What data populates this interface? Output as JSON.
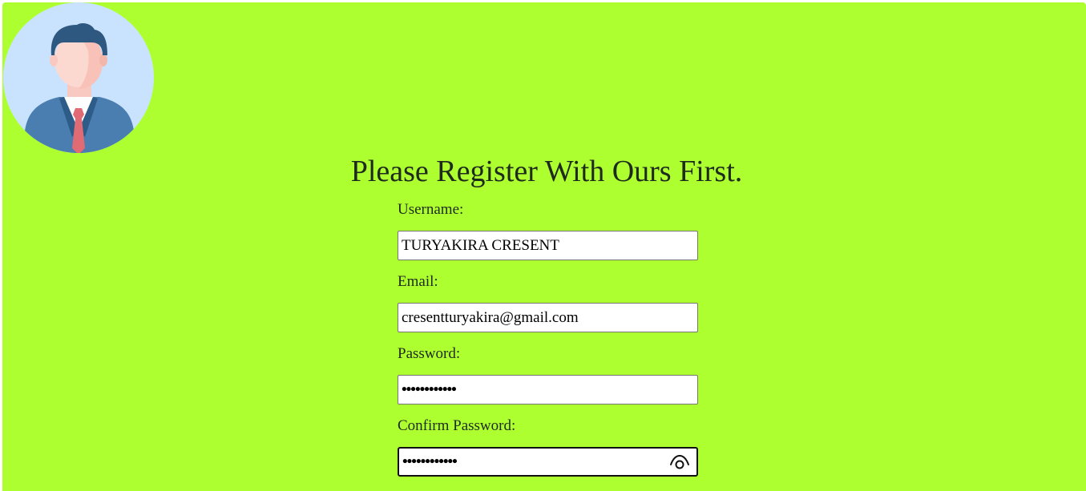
{
  "page": {
    "title": "Please Register With Ours First.",
    "background_color": "#adff2f"
  },
  "avatar": {
    "icon": "businessman-avatar-icon"
  },
  "form": {
    "username": {
      "label": "Username:",
      "value": "TURYAKIRA CRESENT"
    },
    "email": {
      "label": "Email:",
      "value": "cresentturyakira@gmail.com"
    },
    "password": {
      "label": "Password:",
      "value": "••••••••••••"
    },
    "confirm_password": {
      "label": "Confirm Password:",
      "value": "••••••••••••",
      "toggle_icon": "eye-icon"
    }
  }
}
